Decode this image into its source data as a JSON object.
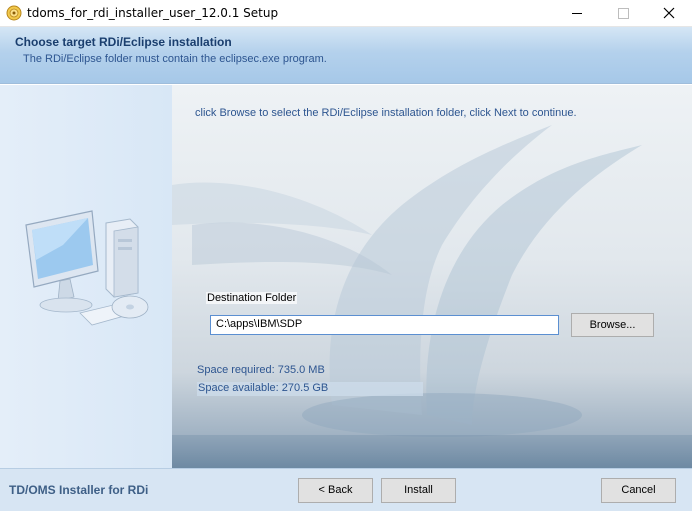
{
  "window": {
    "title": "tdoms_for_rdi_installer_user_12.0.1 Setup",
    "minimize_label": "—",
    "maximize_label": "☐",
    "close_label": "✕"
  },
  "header": {
    "title": "Choose target RDi/Eclipse installation",
    "subtitle": "The RDi/Eclipse folder must contain the eclipsec.exe program."
  },
  "main": {
    "instruction": "click Browse to select the RDi/Eclipse installation folder, click Next to continue.",
    "destination_label": "Destination Folder",
    "destination_value": "C:\\apps\\IBM\\SDP",
    "browse_label": "Browse...",
    "space_required": "Space required: 735.0 MB",
    "space_available": "Space available: 270.5 GB"
  },
  "footer": {
    "brand": "TD/OMS Installer for RDi",
    "back_label": "< Back",
    "install_label": "Install",
    "cancel_label": "Cancel"
  },
  "icons": {
    "app": "installer-icon",
    "side": "computer-icon"
  },
  "colors": {
    "header_text": "#1a3e6e",
    "link_blue": "#2d5590",
    "header_bg": "#b4d1ec",
    "footer_bg": "#d7e5f3"
  }
}
